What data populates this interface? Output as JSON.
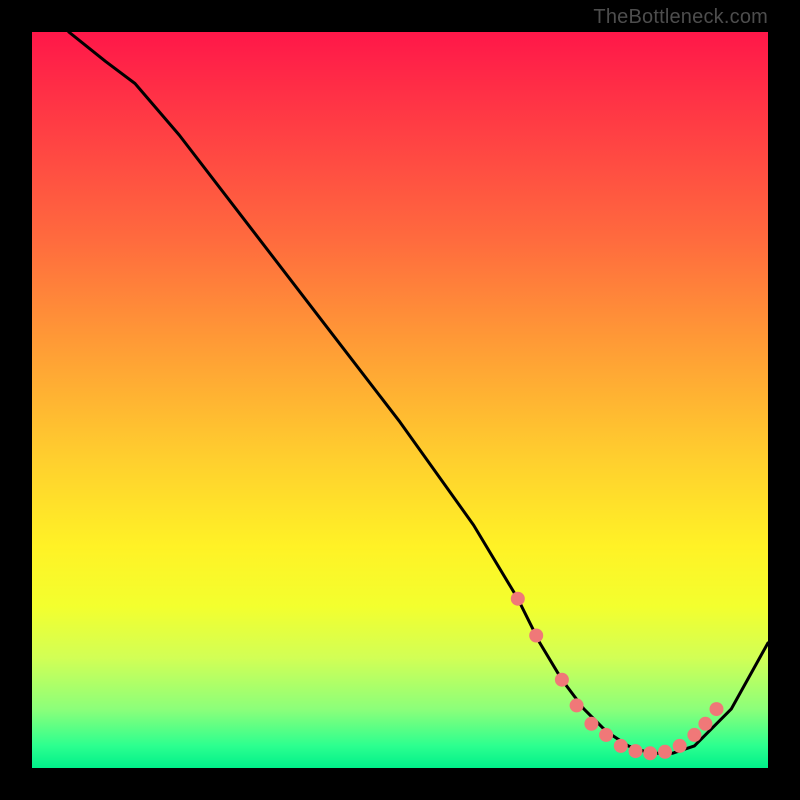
{
  "watermark": "TheBottleneck.com",
  "chart_data": {
    "type": "line",
    "title": "",
    "xlabel": "",
    "ylabel": "",
    "xlim": [
      0,
      100
    ],
    "ylim": [
      0,
      100
    ],
    "grid": false,
    "legend": false,
    "series": [
      {
        "name": "curve",
        "x": [
          5,
          10,
          14,
          20,
          30,
          40,
          50,
          60,
          66,
          69,
          72,
          75,
          78,
          81,
          84,
          87,
          90,
          95,
          100
        ],
        "y": [
          100,
          96,
          93,
          86,
          73,
          60,
          47,
          33,
          23,
          17,
          12,
          8,
          5,
          3,
          2,
          2,
          3,
          8,
          17
        ]
      }
    ],
    "markers": [
      {
        "x": 66,
        "y": 23
      },
      {
        "x": 68.5,
        "y": 18
      },
      {
        "x": 72,
        "y": 12
      },
      {
        "x": 74,
        "y": 8.5
      },
      {
        "x": 76,
        "y": 6
      },
      {
        "x": 78,
        "y": 4.5
      },
      {
        "x": 80,
        "y": 3
      },
      {
        "x": 82,
        "y": 2.3
      },
      {
        "x": 84,
        "y": 2
      },
      {
        "x": 86,
        "y": 2.2
      },
      {
        "x": 88,
        "y": 3
      },
      {
        "x": 90,
        "y": 4.5
      },
      {
        "x": 91.5,
        "y": 6
      },
      {
        "x": 93,
        "y": 8
      }
    ],
    "gradient_stops": [
      {
        "pos": 0,
        "color": "#ff1749"
      },
      {
        "pos": 28,
        "color": "#ff6a3e"
      },
      {
        "pos": 58,
        "color": "#ffcf2e"
      },
      {
        "pos": 78,
        "color": "#f3ff2e"
      },
      {
        "pos": 92,
        "color": "#8cff7a"
      },
      {
        "pos": 100,
        "color": "#00f08a"
      }
    ],
    "marker_color": "#f07878",
    "line_color": "#000000"
  }
}
